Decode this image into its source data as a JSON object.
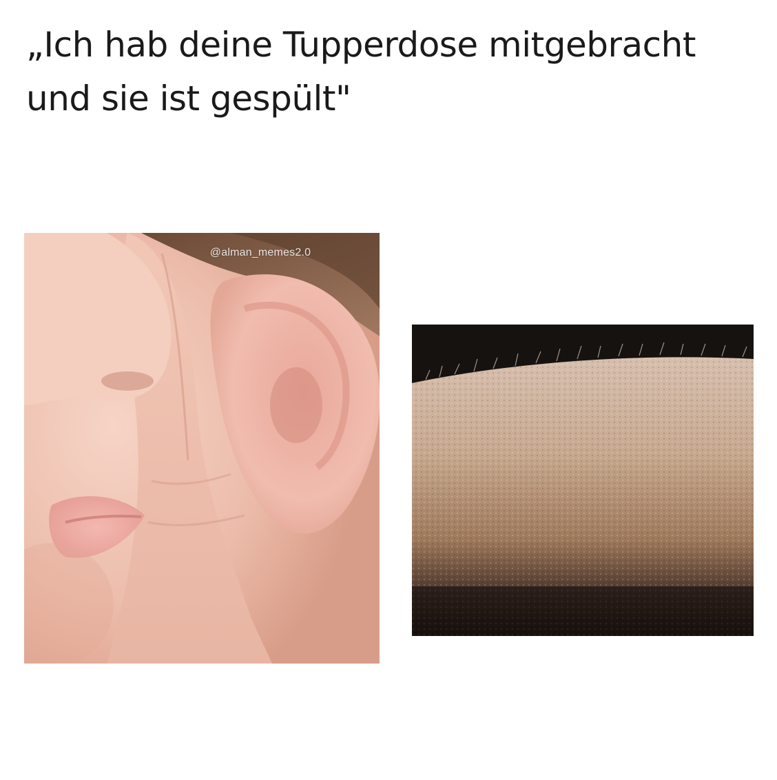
{
  "caption": {
    "line1": "„Ich hab deine Tupperdose mitgebracht",
    "line2": "und sie ist gespült\""
  },
  "left_image": {
    "description_icon": "whisper-ear-photo",
    "watermark": "@alman_memes2.0"
  },
  "right_image": {
    "description_icon": "goosebumps-arm-photo"
  },
  "colors": {
    "background": "#ffffff",
    "text": "#1a1a1a",
    "skin_light": "#efc3b1",
    "skin_arm": "#b08a6c",
    "dark_bg": "#1a1410"
  }
}
